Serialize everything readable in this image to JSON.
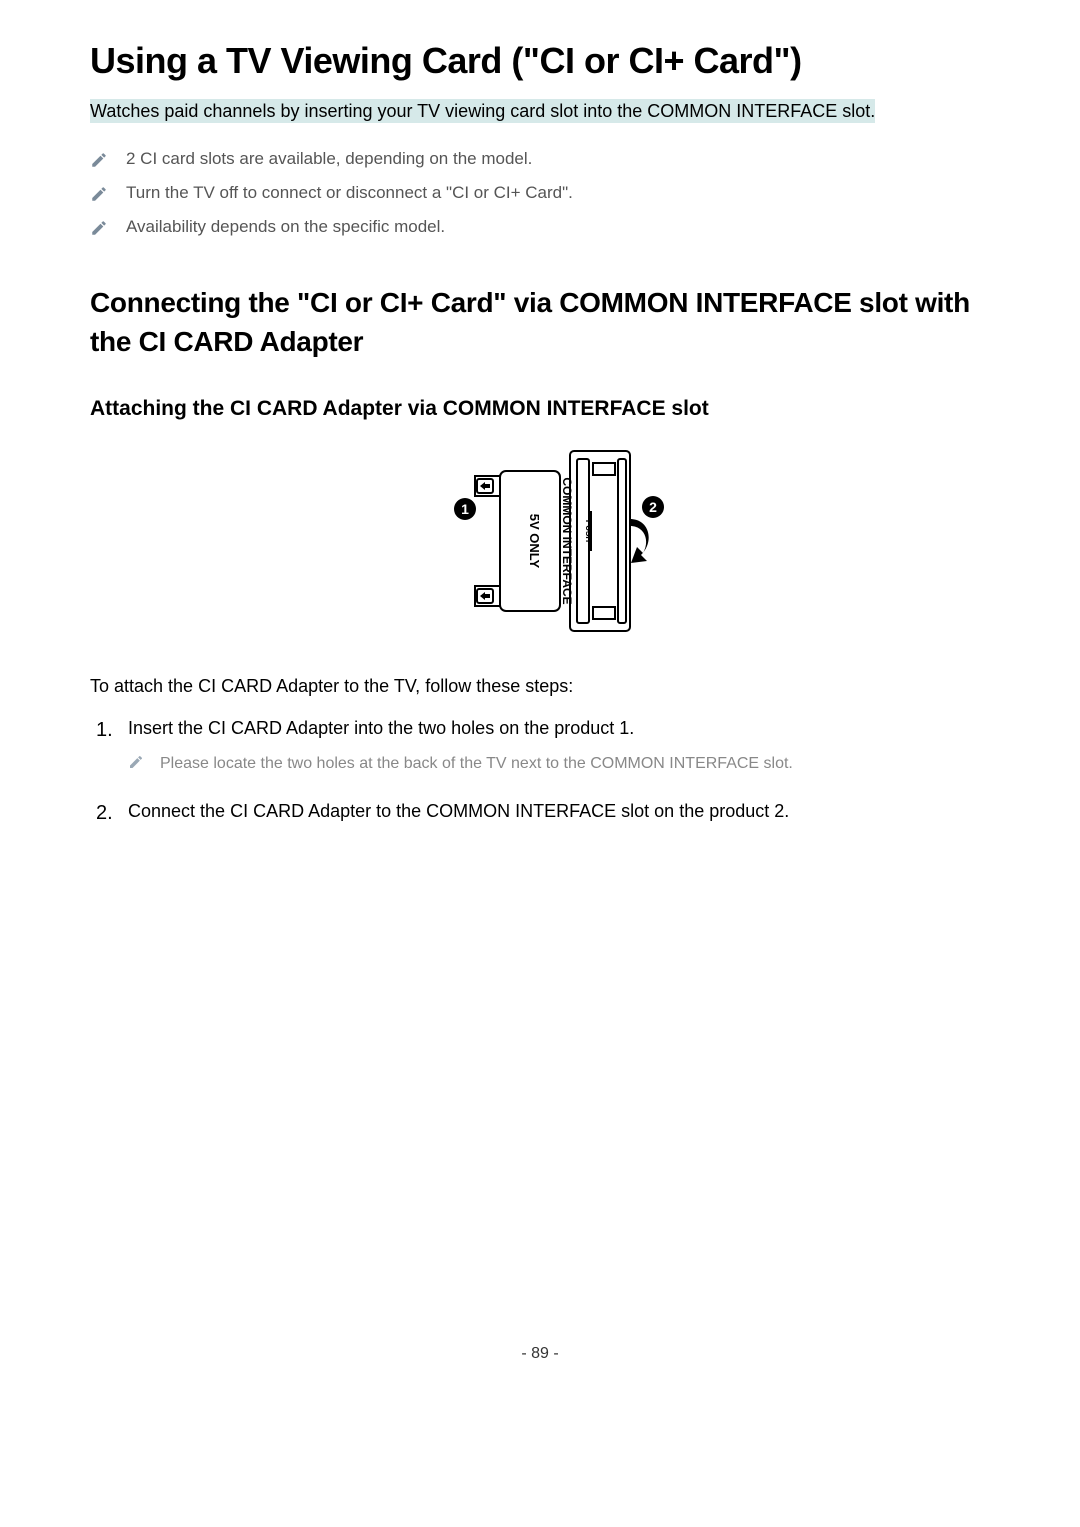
{
  "title": "Using a TV Viewing Card (\"CI or CI+ Card\")",
  "subtitle": "Watches paid channels by inserting your TV viewing card slot into the COMMON INTERFACE slot.",
  "notes": [
    "2 CI card slots are available, depending on the model.",
    "Turn the TV off to connect or disconnect a \"CI or CI+ Card\".",
    "Availability depends on the specific model."
  ],
  "section_heading": "Connecting the \"CI or CI+ Card\" via COMMON INTERFACE slot with the CI CARD Adapter",
  "subsection_heading": "Attaching the CI CARD Adapter via COMMON INTERFACE slot",
  "diagram_labels": {
    "common_interface": "COMMON INTERFACE",
    "five_v_only": "5V ONLY",
    "push": "PUSH"
  },
  "steps_intro": "To attach the CI CARD Adapter to the TV, follow these steps:",
  "steps": [
    {
      "text": "Insert the CI CARD Adapter into the two holes on the product 1.",
      "subnote": "Please locate the two holes at the back of the TV next to the COMMON INTERFACE slot."
    },
    {
      "text": "Connect the CI CARD Adapter to the COMMON INTERFACE slot on the product 2."
    }
  ],
  "page_number": "- 89 -"
}
